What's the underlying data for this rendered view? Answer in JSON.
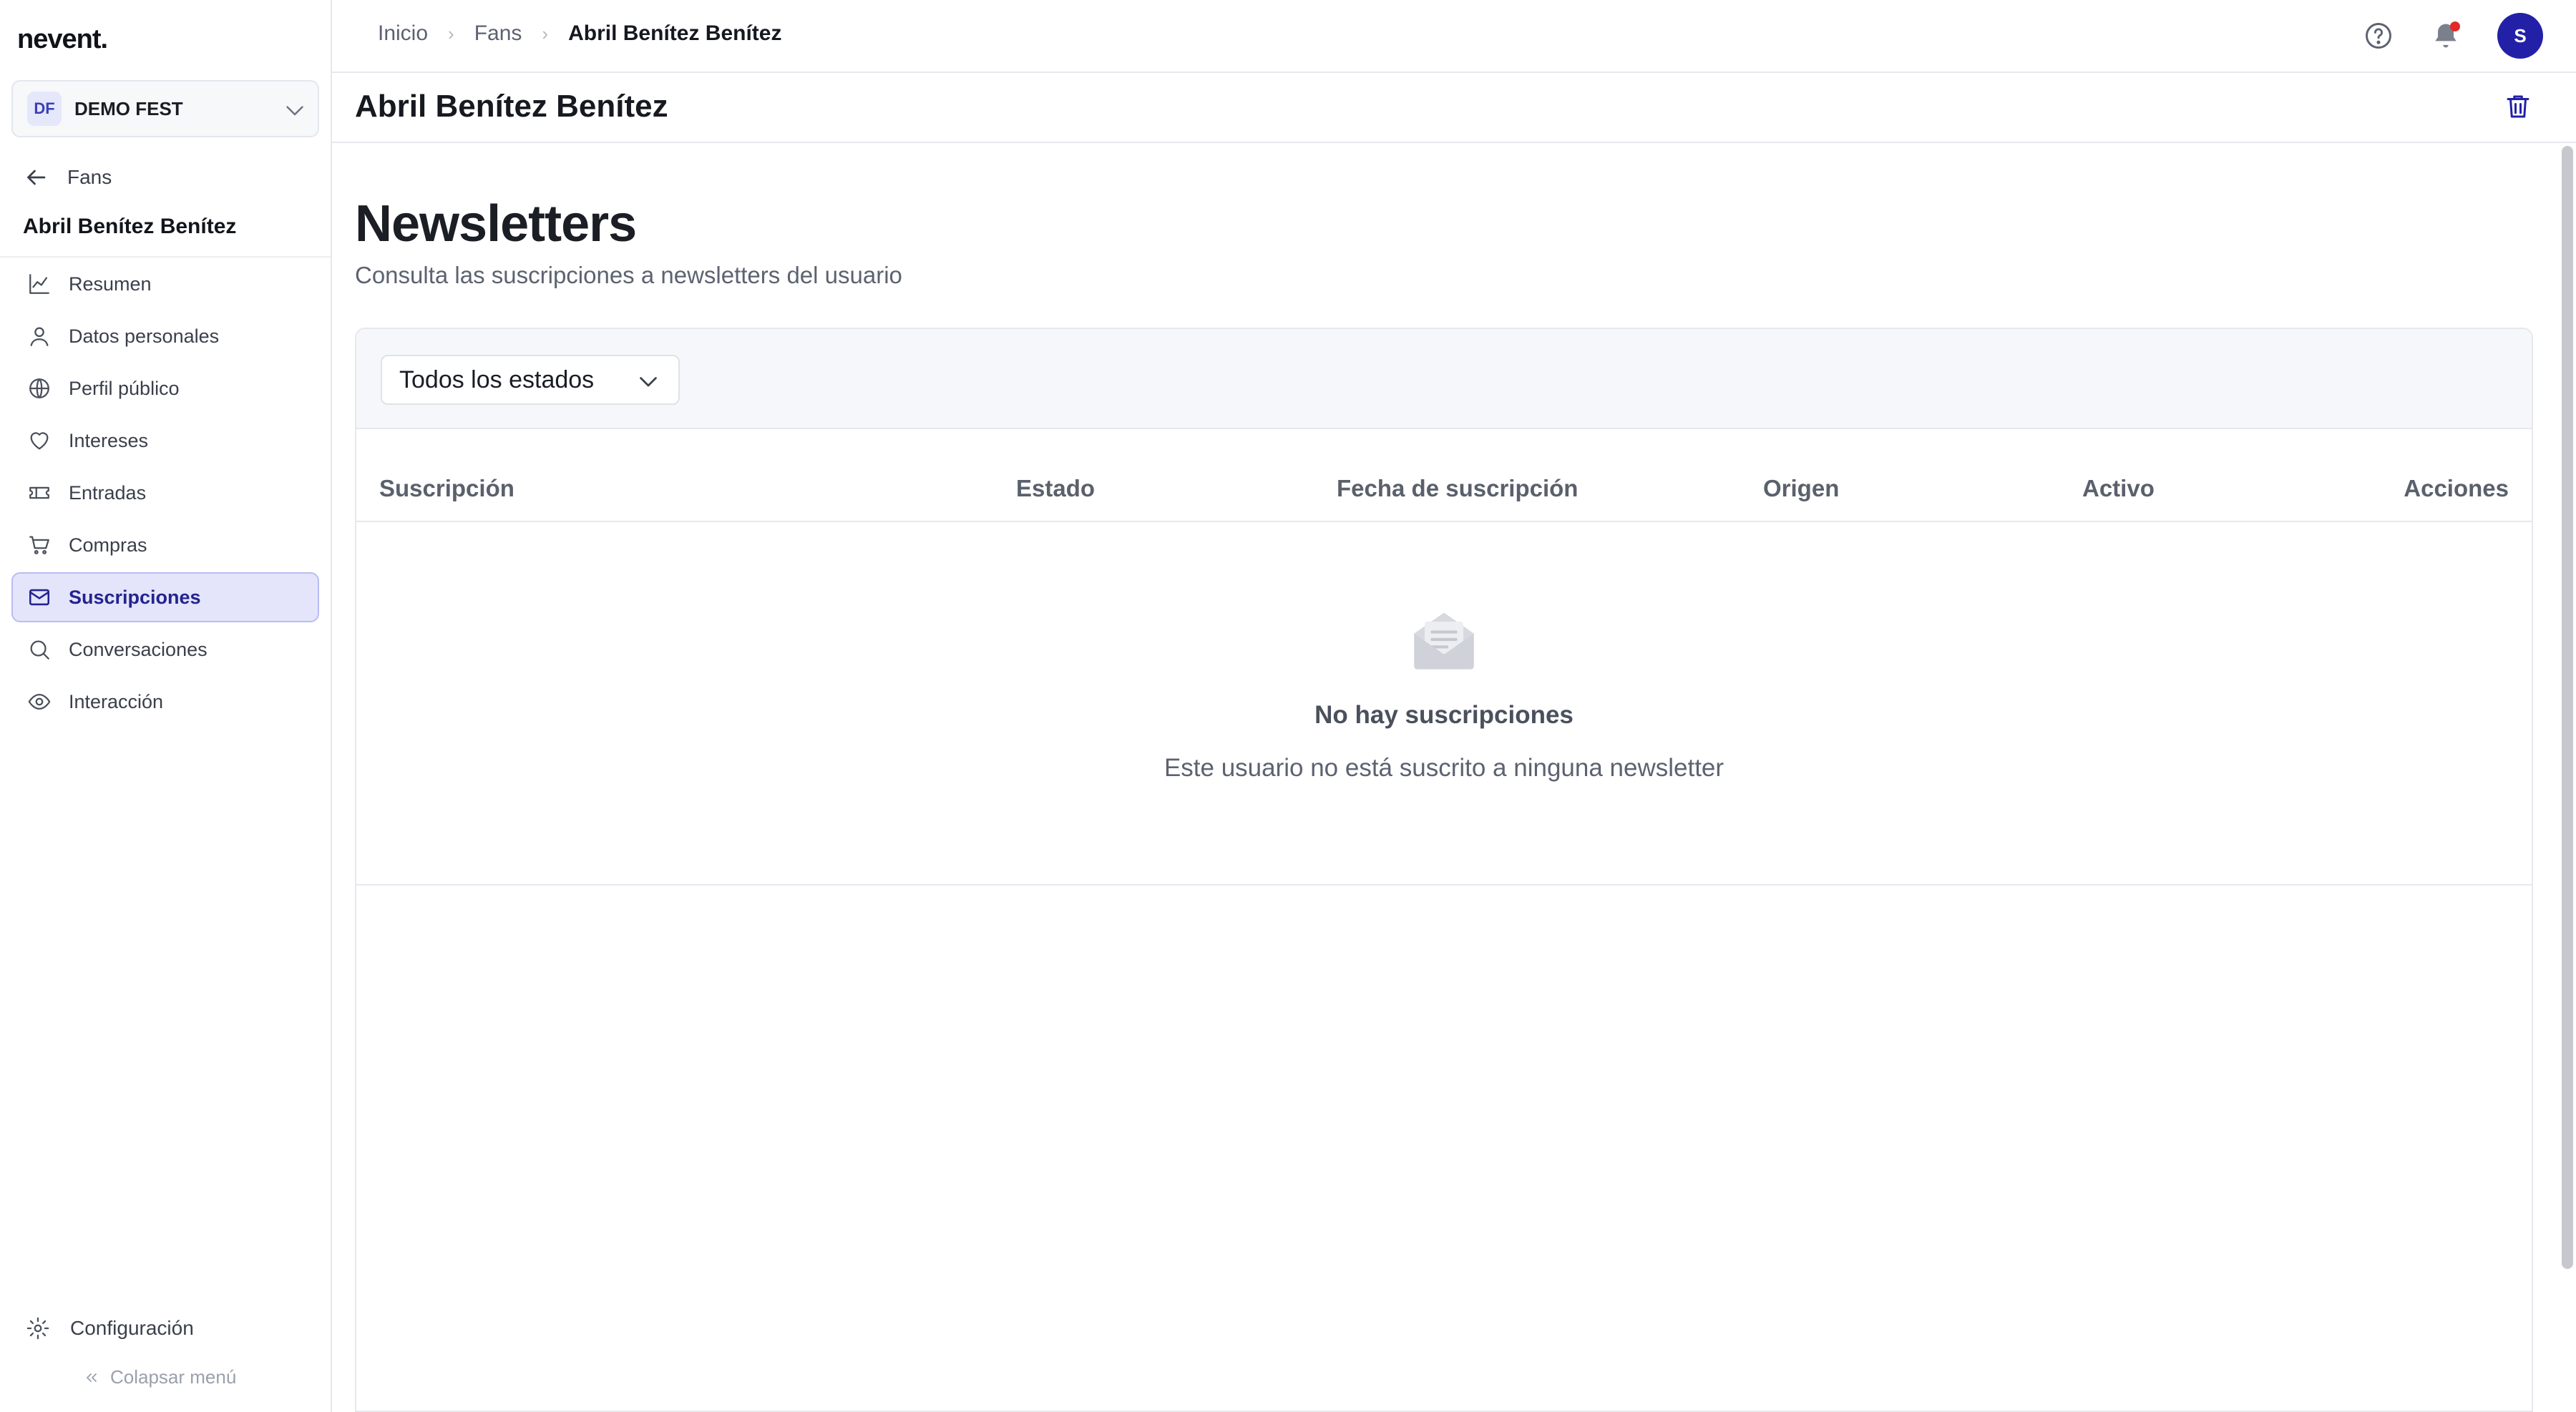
{
  "app": {
    "logo": "nevent."
  },
  "org_select": {
    "badge": "DF",
    "name": "DEMO FEST"
  },
  "sidebar": {
    "back_label": "Fans",
    "profile_name": "Abril Benítez Benítez",
    "items": [
      {
        "label": "Resumen",
        "icon": "chart-line-icon"
      },
      {
        "label": "Datos personales",
        "icon": "user-icon"
      },
      {
        "label": "Perfil público",
        "icon": "globe-icon"
      },
      {
        "label": "Intereses",
        "icon": "heart-icon"
      },
      {
        "label": "Entradas",
        "icon": "ticket-icon"
      },
      {
        "label": "Compras",
        "icon": "cart-icon"
      },
      {
        "label": "Suscripciones",
        "icon": "mail-icon",
        "active": true
      },
      {
        "label": "Conversaciones",
        "icon": "chat-icon"
      },
      {
        "label": "Interacción",
        "icon": "eye-icon"
      }
    ],
    "config_label": "Configuración",
    "collapse_label": "Colapsar menú"
  },
  "topbar": {
    "breadcrumb": [
      "Inicio",
      "Fans",
      "Abril Benítez Benítez"
    ],
    "avatar_initial": "S",
    "notification_dot_color": "#e02b2b"
  },
  "page": {
    "title": "Abril Benítez Benítez"
  },
  "section": {
    "title": "Newsletters",
    "subtitle": "Consulta las suscripciones a newsletters del usuario"
  },
  "filter": {
    "state_value": "Todos los estados"
  },
  "table": {
    "columns": [
      "Suscripción",
      "Estado",
      "Fecha de suscripción",
      "Origen",
      "Activo",
      "Acciones"
    ]
  },
  "empty": {
    "title": "No hay suscripciones",
    "description": "Este usuario no está suscrito a ninguna newsletter"
  },
  "colors": {
    "accent": "#2320a8",
    "active_bg": "#e4e5fb"
  }
}
